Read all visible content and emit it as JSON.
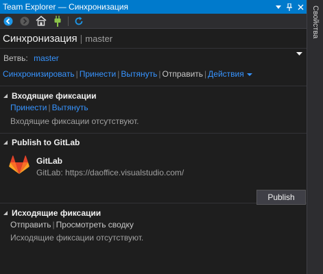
{
  "window": {
    "title": "Team Explorer — Синхронизация",
    "controls": [
      "dropdown-icon",
      "pin-icon",
      "close-icon"
    ]
  },
  "toolbar": {
    "icons": [
      "back-icon",
      "forward-icon",
      "home-icon",
      "connect-icon",
      "refresh-icon"
    ]
  },
  "header": {
    "title": "Синхронизация",
    "separator": "|",
    "branch": "master"
  },
  "branch_row": {
    "label": "Ветвь:",
    "value": "master"
  },
  "actions": {
    "sync": "Синхронизировать",
    "fetch": "Принести",
    "pull": "Вытянуть",
    "push": "Отправить",
    "more": "Действия"
  },
  "incoming": {
    "title": "Входящие фиксации",
    "fetch": "Принести",
    "pull": "Вытянуть",
    "empty": "Входящие фиксации отсутствуют."
  },
  "publish": {
    "title": "Publish to GitLab",
    "service": "GitLab",
    "url": "GitLab: https://daoffice.visualstudio.com/",
    "button": "Publish"
  },
  "outgoing": {
    "title": "Исходящие фиксации",
    "push": "Отправить",
    "summary": "Просмотреть сводку",
    "empty": "Исходящие фиксации отсутствуют."
  },
  "sidebar": {
    "tab": "Свойства"
  },
  "colors": {
    "accent": "#007acc",
    "link": "#3794ff",
    "background": "#1e1e1e",
    "gitlab_orange": "#fc6d26"
  }
}
